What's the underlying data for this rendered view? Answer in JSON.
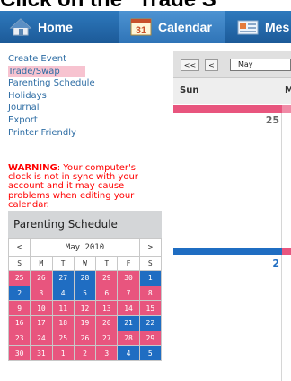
{
  "headline": "Click on the \"Trade S",
  "nav": {
    "tabs": [
      {
        "label": "Home"
      },
      {
        "label": "Calendar"
      },
      {
        "label": "Mes"
      }
    ],
    "calendar_icon_text": "31"
  },
  "sidebar": {
    "links": [
      {
        "label": "Create Event"
      },
      {
        "label": "Trade/Swap"
      },
      {
        "label": "Parenting Schedule"
      },
      {
        "label": "Holidays"
      },
      {
        "label": "Journal"
      },
      {
        "label": "Export"
      },
      {
        "label": "Printer Friendly"
      }
    ],
    "warning_label": "WARNING",
    "warning_text": ": Your computer's clock is not in sync with your account and it may cause problems when editing your calendar."
  },
  "minical": {
    "title": "Parenting Schedule",
    "prev": "<",
    "next": ">",
    "month_label": "May 2010",
    "dow": [
      "S",
      "M",
      "T",
      "W",
      "T",
      "F",
      "S"
    ],
    "weeks": [
      [
        {
          "d": "25",
          "c": "pink"
        },
        {
          "d": "26",
          "c": "pink"
        },
        {
          "d": "27",
          "c": "blue"
        },
        {
          "d": "28",
          "c": "blue"
        },
        {
          "d": "29",
          "c": "pink"
        },
        {
          "d": "30",
          "c": "pink"
        },
        {
          "d": "1",
          "c": "blue"
        }
      ],
      [
        {
          "d": "2",
          "c": "blue"
        },
        {
          "d": "3",
          "c": "pink"
        },
        {
          "d": "4",
          "c": "blue"
        },
        {
          "d": "5",
          "c": "blue"
        },
        {
          "d": "6",
          "c": "pink"
        },
        {
          "d": "7",
          "c": "pink"
        },
        {
          "d": "8",
          "c": "pink"
        }
      ],
      [
        {
          "d": "9",
          "c": "pink"
        },
        {
          "d": "10",
          "c": "pink"
        },
        {
          "d": "11",
          "c": "pink"
        },
        {
          "d": "12",
          "c": "pink"
        },
        {
          "d": "13",
          "c": "pink"
        },
        {
          "d": "14",
          "c": "pink"
        },
        {
          "d": "15",
          "c": "pink"
        }
      ],
      [
        {
          "d": "16",
          "c": "pink"
        },
        {
          "d": "17",
          "c": "pink"
        },
        {
          "d": "18",
          "c": "pink"
        },
        {
          "d": "19",
          "c": "pink"
        },
        {
          "d": "20",
          "c": "pink"
        },
        {
          "d": "21",
          "c": "blue"
        },
        {
          "d": "22",
          "c": "blue"
        }
      ],
      [
        {
          "d": "23",
          "c": "pink"
        },
        {
          "d": "24",
          "c": "pink"
        },
        {
          "d": "25",
          "c": "pink"
        },
        {
          "d": "26",
          "c": "pink"
        },
        {
          "d": "27",
          "c": "pink"
        },
        {
          "d": "28",
          "c": "pink"
        },
        {
          "d": "29",
          "c": "pink"
        }
      ],
      [
        {
          "d": "30",
          "c": "pink"
        },
        {
          "d": "31",
          "c": "pink"
        },
        {
          "d": "1",
          "c": "pink"
        },
        {
          "d": "2",
          "c": "pink"
        },
        {
          "d": "3",
          "c": "pink"
        },
        {
          "d": "4",
          "c": "blue"
        },
        {
          "d": "5",
          "c": "blue"
        }
      ]
    ]
  },
  "main": {
    "btn_first": "<<",
    "btn_prev": "<",
    "month_select": "May",
    "dow_sun": "Sun",
    "dow_mon": "M",
    "week1_day": "25",
    "week2_day": "2"
  },
  "colors": {
    "pink": "#e8557e",
    "blue": "#1f6dc2",
    "link": "#2e6da4",
    "warning": "#ff0000",
    "nav": "#1c5a98"
  }
}
